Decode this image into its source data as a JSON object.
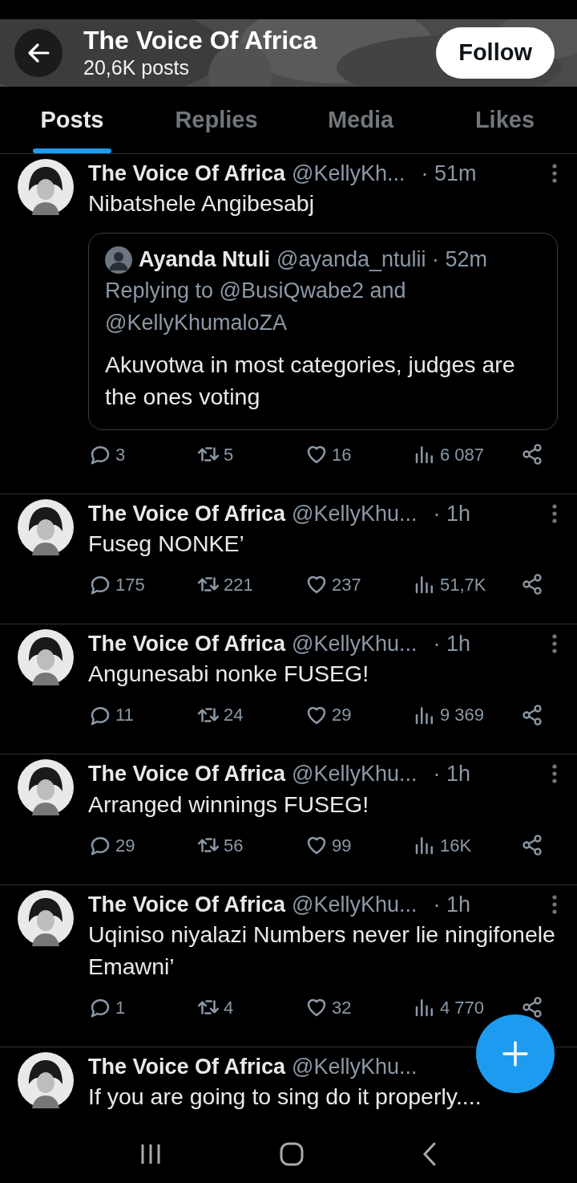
{
  "header": {
    "title": "The Voice Of Africa",
    "subtitle": "20,6K posts",
    "follow_button": "Follow"
  },
  "tabs": [
    {
      "label": "Posts",
      "selected": true
    },
    {
      "label": "Replies",
      "selected": false
    },
    {
      "label": "Media",
      "selected": false
    },
    {
      "label": "Likes",
      "selected": false
    }
  ],
  "posts": [
    {
      "name": "The Voice Of Africa",
      "handle": "@KellyKh...",
      "time": "· 51m",
      "text": "Nibatshele Angibesabj",
      "quote": {
        "name": "Ayanda Ntuli",
        "handle": "@ayanda_ntulii",
        "time": "· 52m",
        "replying_to": "Replying to @BusiQwabe2 and @KellyKhumaloZA",
        "text": "Akuvotwa in most categories, judges are the ones voting"
      },
      "stats": {
        "replies": "3",
        "reposts": "5",
        "likes": "16",
        "views": "6 087"
      }
    },
    {
      "name": "The Voice Of Africa",
      "handle": "@KellyKhu...",
      "time": "· 1h",
      "text": "Fuseg NONKE’",
      "stats": {
        "replies": "175",
        "reposts": "221",
        "likes": "237",
        "views": "51,7K"
      }
    },
    {
      "name": "The Voice Of Africa",
      "handle": "@KellyKhu...",
      "time": "· 1h",
      "text": "Angunesabi nonke FUSEG!",
      "stats": {
        "replies": "11",
        "reposts": "24",
        "likes": "29",
        "views": "9 369"
      }
    },
    {
      "name": "The Voice Of Africa",
      "handle": "@KellyKhu...",
      "time": "· 1h",
      "text": "Arranged winnings FUSEG!",
      "stats": {
        "replies": "29",
        "reposts": "56",
        "likes": "99",
        "views": "16K"
      }
    },
    {
      "name": "The Voice Of Africa",
      "handle": "@KellyKhu...",
      "time": "· 1h",
      "text": "Uqiniso niyalazi  Numbers  never lie ningifonele Emawni’",
      "stats": {
        "replies": "1",
        "reposts": "4",
        "likes": "32",
        "views": "4 770"
      }
    },
    {
      "name": "The Voice Of Africa",
      "handle": "@KellyKhu...",
      "text": "If you are going to sing do it properly...."
    }
  ]
}
